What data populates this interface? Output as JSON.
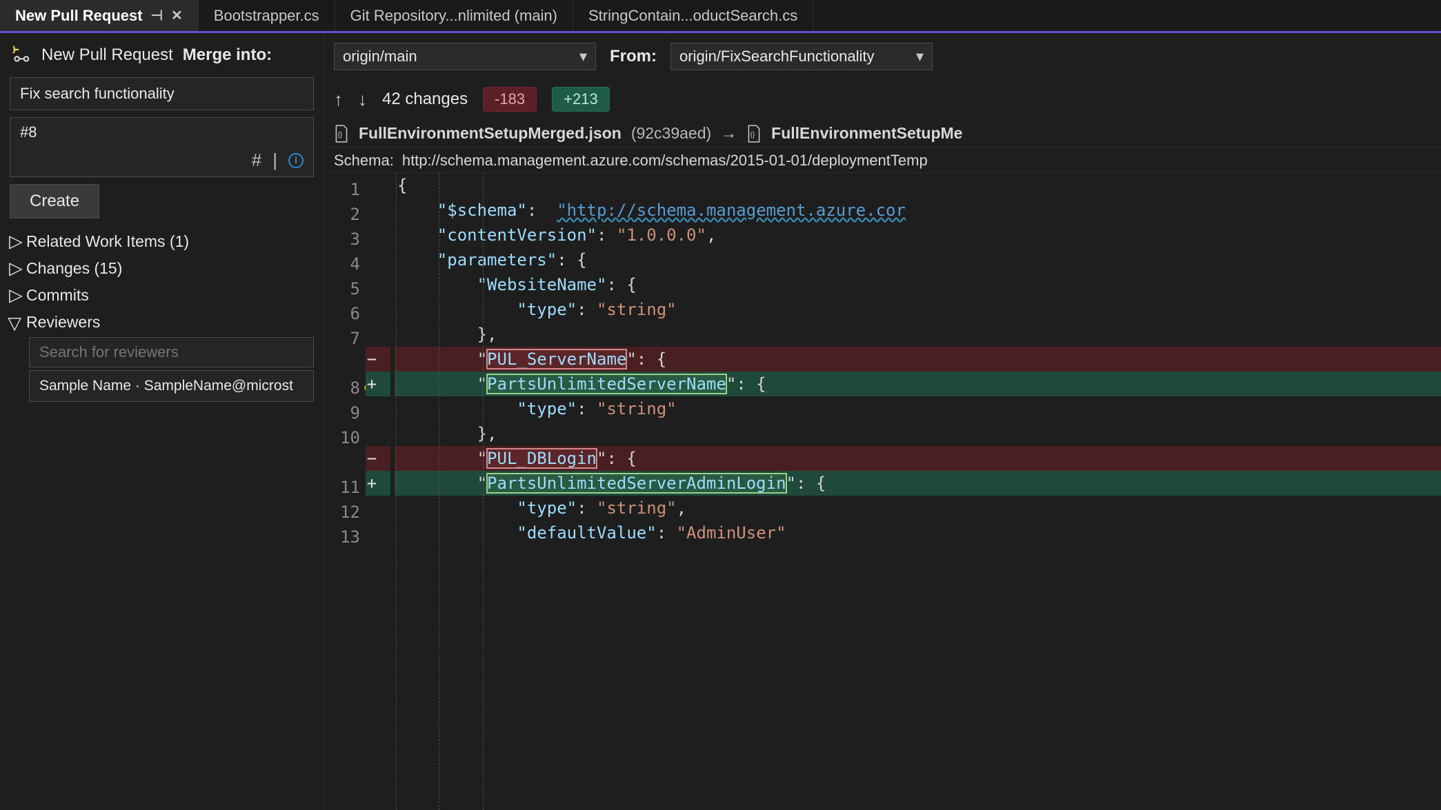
{
  "tabs": [
    {
      "label": "New Pull Request",
      "active": true,
      "pinned": true,
      "closeable": true
    },
    {
      "label": "Bootstrapper.cs"
    },
    {
      "label": "Git Repository...nlimited (main)"
    },
    {
      "label": "StringContain...oductSearch.cs"
    }
  ],
  "leftPane": {
    "iconTitle": "New Pull Request",
    "mergeIntoLabel": "Merge into:",
    "titleField": "Fix search functionality",
    "linkedField": "#8",
    "hashGlyph": "#",
    "pipeGlyph": "|",
    "createLabel": "Create",
    "tree": {
      "relatedWorkItems": "Related Work Items (1)",
      "changes": "Changes (15)",
      "commits": "Commits",
      "reviewers": "Reviewers",
      "reviewerSearchPlaceholder": "Search for reviewers",
      "reviewerChip": "Sample Name · SampleName@microst"
    }
  },
  "rightPane": {
    "mergeIntoLabel": "Merge into:",
    "mergeIntoBranch": "origin/main",
    "fromLabel": "From:",
    "fromBranch": "origin/FixSearchFunctionality",
    "changesText": "42 changes",
    "deletions": "-183",
    "additions": "+213",
    "fileLeft": "FullEnvironmentSetupMerged.json",
    "fileHash": "(92c39aed)",
    "arrow": "→",
    "fileRight": "FullEnvironmentSetupMe",
    "schemaLabel": "Schema:",
    "schemaValue": "http://schema.management.azure.com/schemas/2015-01-01/deploymentTemp"
  },
  "code": {
    "lineNumbers": [
      "1",
      "2",
      "3",
      "4",
      "5",
      "6",
      "7",
      "",
      "8",
      "9",
      "10",
      "",
      "11",
      "12",
      "13"
    ],
    "schemaKey": "\"$schema\"",
    "schemaVal": "\"http://schema.management.azure.cor",
    "contentVersionKey": "\"contentVersion\"",
    "contentVersionVal": "\"1.0.0.0\"",
    "parametersKey": "\"parameters\"",
    "websiteNameKey": "\"WebsiteName\"",
    "typeKey1": "\"type\"",
    "typeVal1": "\"string\"",
    "delKey1": "PUL_ServerName",
    "addKey1": "PartsUnlimitedServerName",
    "typeKey2": "\"type\"",
    "typeVal2": "\"string\"",
    "delKey2": "PUL_DBLogin",
    "addKey2": "PartsUnlimitedServerAdminLogin",
    "typeKey3": "\"type\"",
    "typeVal3": "\"string\"",
    "defaultKey": "\"defaultValue\"",
    "defaultVal": "\"AdminUser\""
  }
}
